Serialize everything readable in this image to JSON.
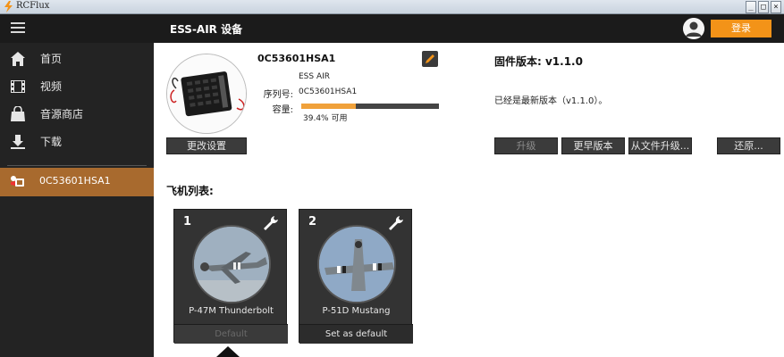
{
  "window": {
    "title": "RCFlux"
  },
  "header": {
    "device_title": "ESS-AIR 设备",
    "login_label": "登录"
  },
  "sidebar": {
    "items": [
      {
        "label": "首页",
        "icon": "home-icon"
      },
      {
        "label": "视频",
        "icon": "film-icon"
      },
      {
        "label": "音源商店",
        "icon": "shopping-bag-icon"
      },
      {
        "label": "下载",
        "icon": "download-icon"
      }
    ],
    "active_device": {
      "label": "0C53601HSA1",
      "icon": "device-icon"
    }
  },
  "device": {
    "name": "0C53601HSA1",
    "model": "ESS AIR",
    "serial_label": "序列号:",
    "serial_value": "0C53601HSA1",
    "capacity_label": "容量:",
    "capacity_fraction": 0.394,
    "capacity_text": "39.4% 可用",
    "change_settings_label": "更改设置"
  },
  "firmware": {
    "title": "固件版本: v1.1.0",
    "status": "已经是最新版本（v1.1.0）。",
    "buttons": {
      "upgrade": "升级",
      "older_version": "更早版本",
      "from_file": "从文件升级...",
      "restore": "还原..."
    }
  },
  "aircraft": {
    "heading": "飞机列表:",
    "cards": [
      {
        "number": "1",
        "name": "P-47M Thunderbolt",
        "default_label": "Default"
      },
      {
        "number": "2",
        "name": "P-51D Mustang",
        "default_label": "Set as default"
      }
    ]
  },
  "colors": {
    "accent": "#f39318",
    "active_sidebar": "#a86a2e",
    "sidebar_bg": "#232323",
    "header_bg": "#1b1b1b"
  }
}
